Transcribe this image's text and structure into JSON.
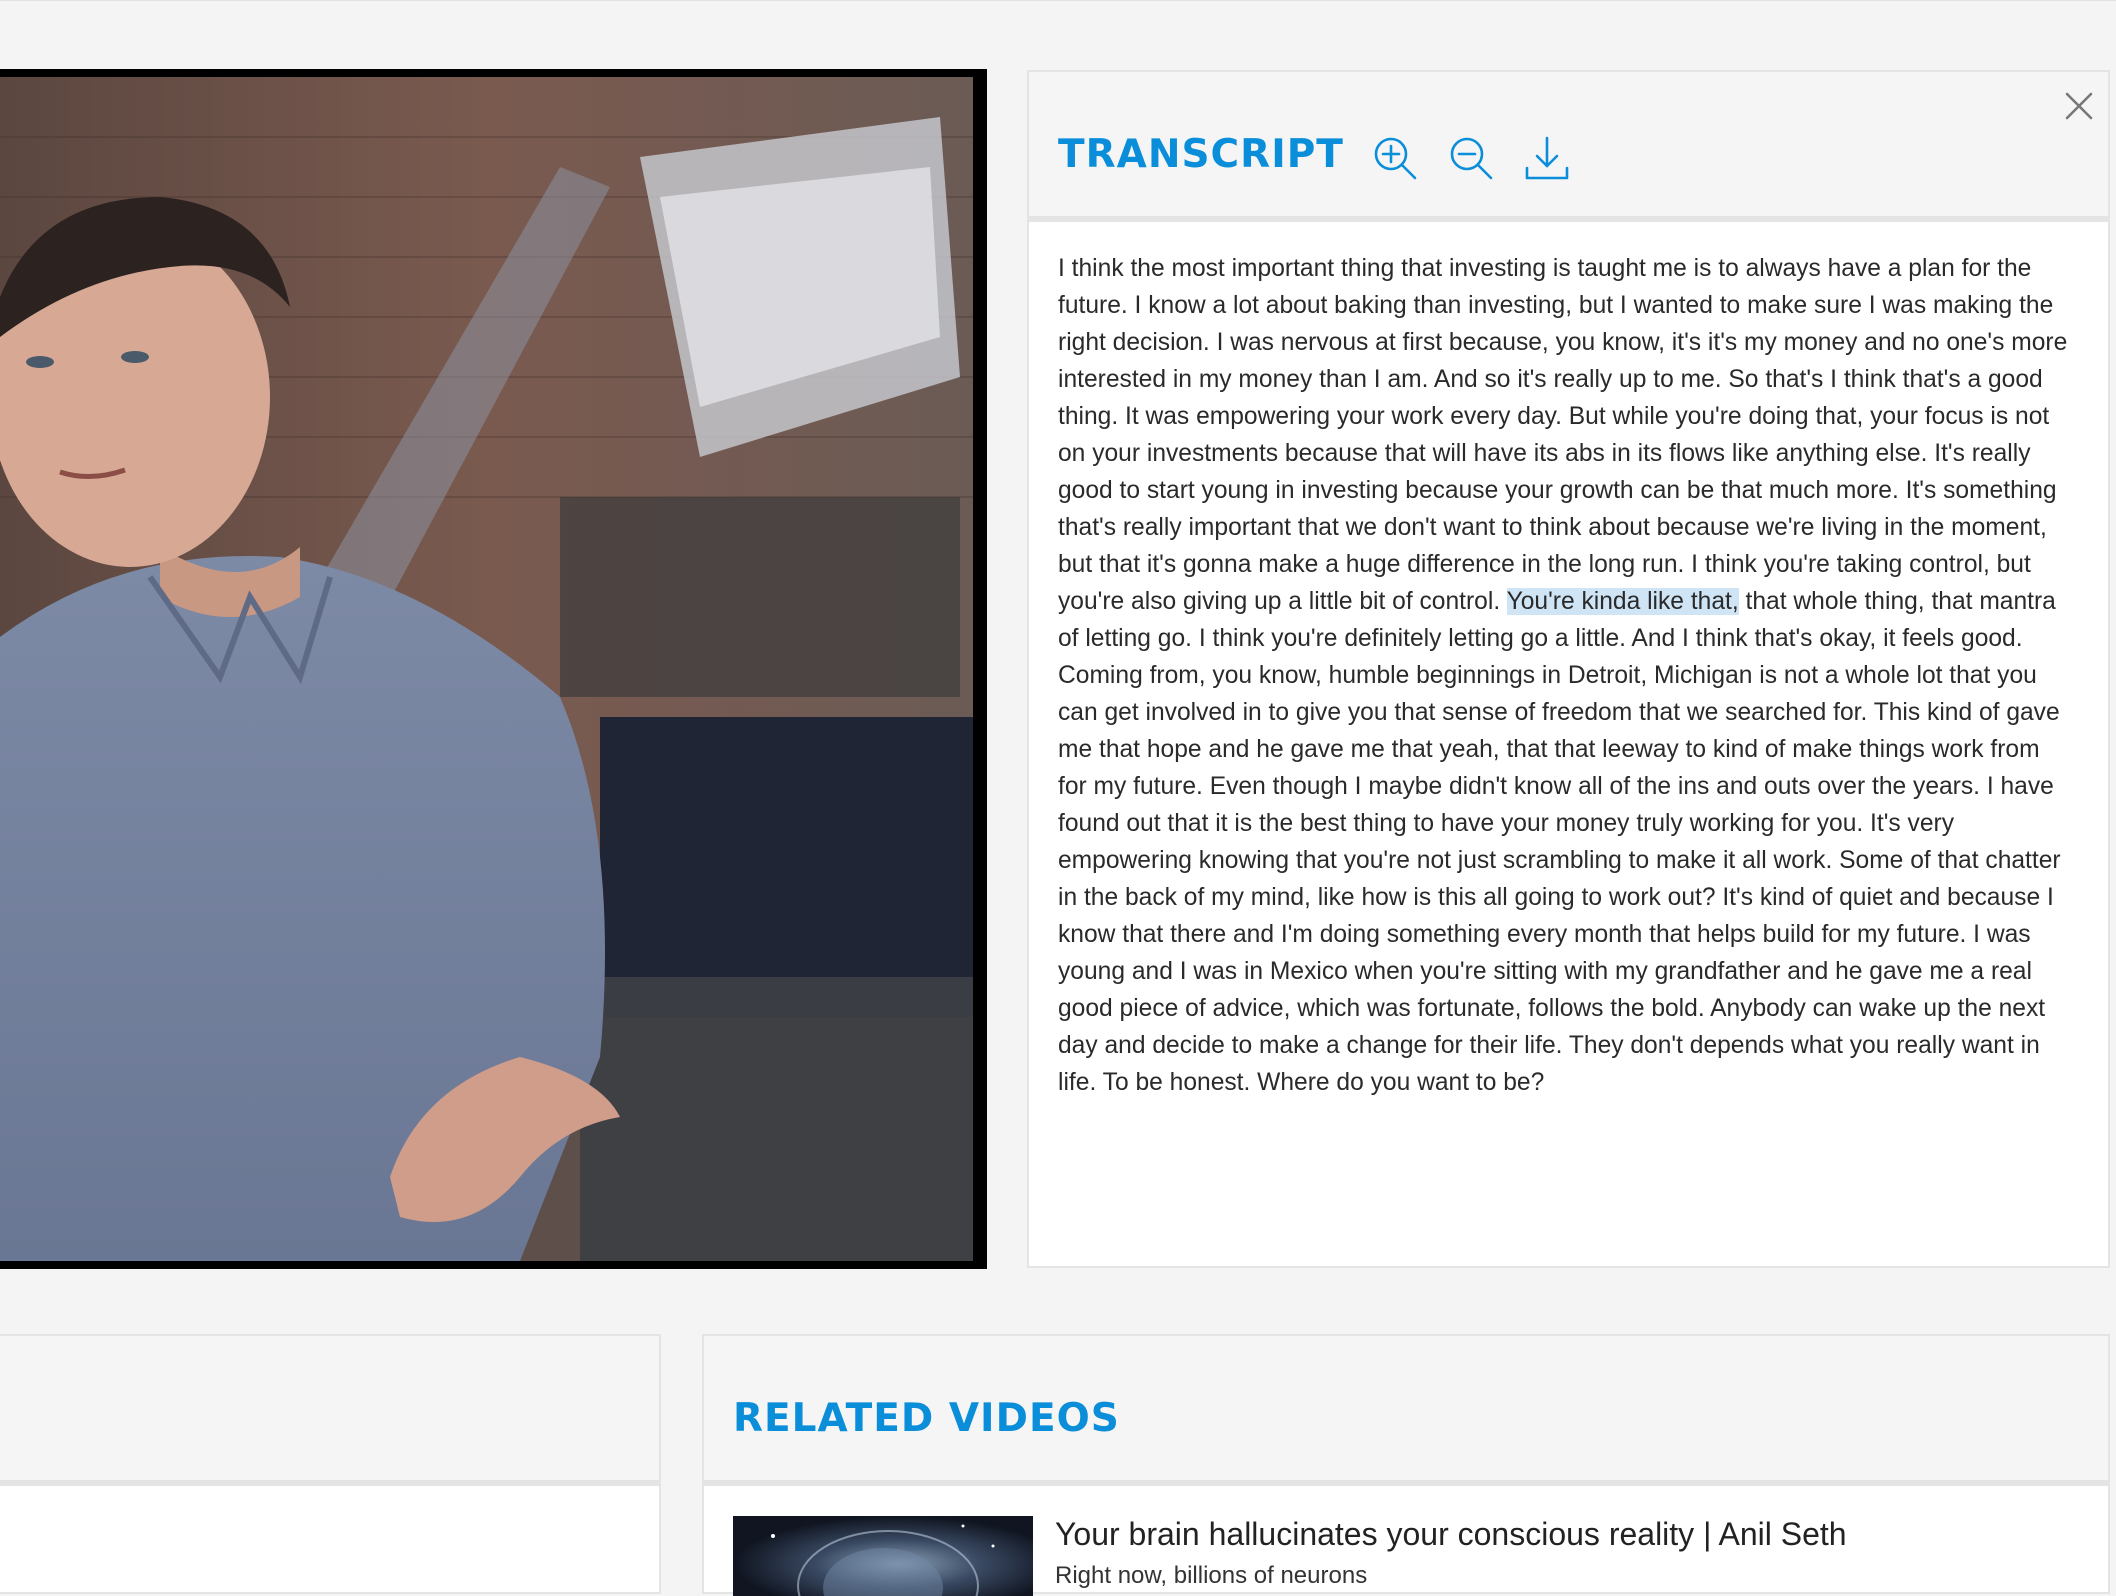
{
  "player": {
    "icon": "video-frame"
  },
  "transcript": {
    "title": "TRANSCRIPT",
    "icons": [
      "zoom-in-icon",
      "zoom-out-icon",
      "download-icon",
      "close-icon"
    ],
    "text_before": "I think the most important thing that investing is taught me is to always have a plan for the future. I know a lot about baking than investing, but I wanted to make sure I was making the right decision. I was nervous at first because, you know, it's it's my money and no one's more interested in my money than I am. And so it's really up to me. So that's I think that's a good thing. It was empowering your work every day. But while you're doing that, your focus is not on your investments because that will have its abs in its flows like anything else. It's really good to start young in investing because your growth can be that much more. It's something that's really important that we don't want to think about because we're living in the moment, but that it's gonna make a huge difference in the long run. I think you're taking control, but you're also giving up a little bit of control. ",
    "text_highlight": "You're kinda like that,",
    "text_after": " that whole thing, that mantra of letting go. I think you're definitely letting go a little. And I think that's okay, it feels good. Coming from, you know, humble beginnings in Detroit, Michigan is not a whole lot that you can get involved in to give you that sense of freedom that we searched for. This kind of gave me that hope and he gave me that yeah, that that leeway to kind of make things work from for my future. Even though I maybe didn't know all of the ins and outs over the years. I have found out that it is the best thing to have your money truly working for you. It's very empowering knowing that you're not just scrambling to make it all work. Some of that chatter in the back of my mind, like how is this all going to work out? It's kind of quiet and because I know that there and I'm doing something every month that helps build for my future. I was young and I was in Mexico when you're sitting with my grandfather and he gave me a real good piece of advice, which was fortunate, follows the bold. Anybody can wake up the next day and decide to make a change for their life. They don't depends what you really want in life. To be honest. Where do you want to be?"
  },
  "related": {
    "title": "RELATED VIDEOS",
    "items": [
      {
        "title": "Your brain hallucinates your conscious reality | Anil Seth",
        "description": "Right now, billions of neurons"
      }
    ]
  },
  "colors": {
    "accent": "#0b8ed9",
    "highlight": "#cfe5f6",
    "panel_header": "#f5f5f5",
    "border": "#e4e4e4"
  }
}
